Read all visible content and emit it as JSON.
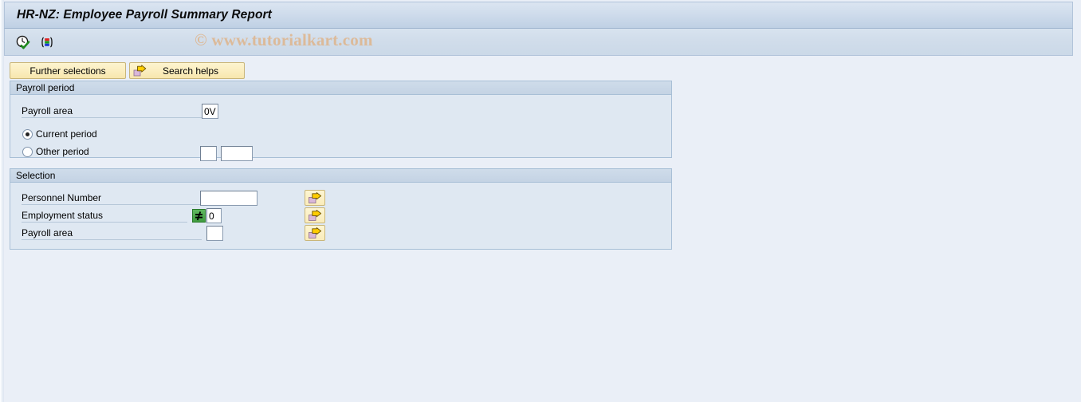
{
  "window": {
    "title": "HR-NZ: Employee Payroll Summary Report"
  },
  "watermark": {
    "text": "© www.tutorialkart.com"
  },
  "toolbar": {
    "icons": [
      {
        "name": "execute-clock-check-icon",
        "title": "Execute"
      },
      {
        "name": "variant-selection-icon",
        "title": "Get Variant"
      }
    ]
  },
  "buttons": {
    "further_selections": "Further selections",
    "search_helps": "Search helps"
  },
  "payroll_period": {
    "group_title": "Payroll period",
    "payroll_area_label": "Payroll area",
    "payroll_area_value": "0V",
    "current_period_label": "Current period",
    "other_period_label": "Other period",
    "selected_option": "current_period",
    "other_period_value_1": "",
    "other_period_value_2": ""
  },
  "selection": {
    "group_title": "Selection",
    "rows": [
      {
        "label": "Personnel Number",
        "value": "",
        "has_operator": false,
        "operator": "",
        "multi_select_icon": "multiple-selection-arrow-icon"
      },
      {
        "label": "Employment status",
        "value": "0",
        "has_operator": true,
        "operator": "≠",
        "multi_select_icon": "multiple-selection-arrow-icon"
      },
      {
        "label": "Payroll area",
        "value": "",
        "has_operator": false,
        "operator": "",
        "multi_select_icon": "multiple-selection-arrow-icon"
      }
    ]
  },
  "colors": {
    "page_background": "#eaeff7",
    "title_bar": "#cfdcec",
    "group_background": "#dfe8f2",
    "button_yellow": "#fbeec0",
    "operator_green": "#3f9b3f",
    "watermark": "#e0b183"
  }
}
